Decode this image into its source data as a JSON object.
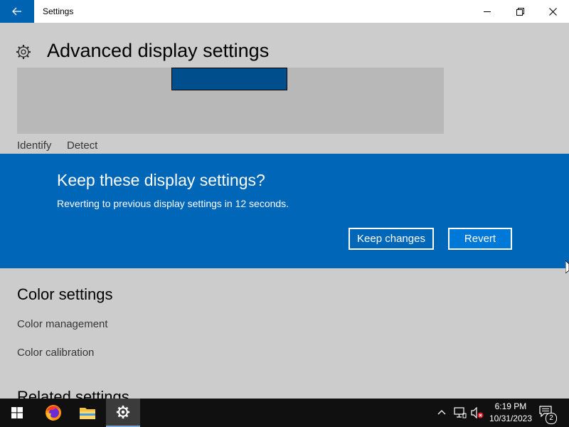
{
  "window": {
    "title": "Settings"
  },
  "page": {
    "title": "Advanced display settings",
    "links": {
      "identify": "Identify",
      "detect": "Detect"
    },
    "color_settings": {
      "heading": "Color settings",
      "color_management": "Color management",
      "color_calibration": "Color calibration"
    },
    "related_heading": "Related settings"
  },
  "dialog": {
    "title": "Keep these display settings?",
    "message": "Reverting to previous display settings in 12 seconds.",
    "keep_label": "Keep changes",
    "revert_label": "Revert"
  },
  "taskbar": {
    "apps": [
      "start",
      "firefox",
      "file-explorer",
      "settings"
    ],
    "time": "6:19 PM",
    "date": "10/31/2023",
    "notification_count": "2"
  },
  "colors": {
    "accent": "#0067b8",
    "accent_back": "#0063b1",
    "revert_button": "#0078d7",
    "taskbar": "#101010"
  }
}
